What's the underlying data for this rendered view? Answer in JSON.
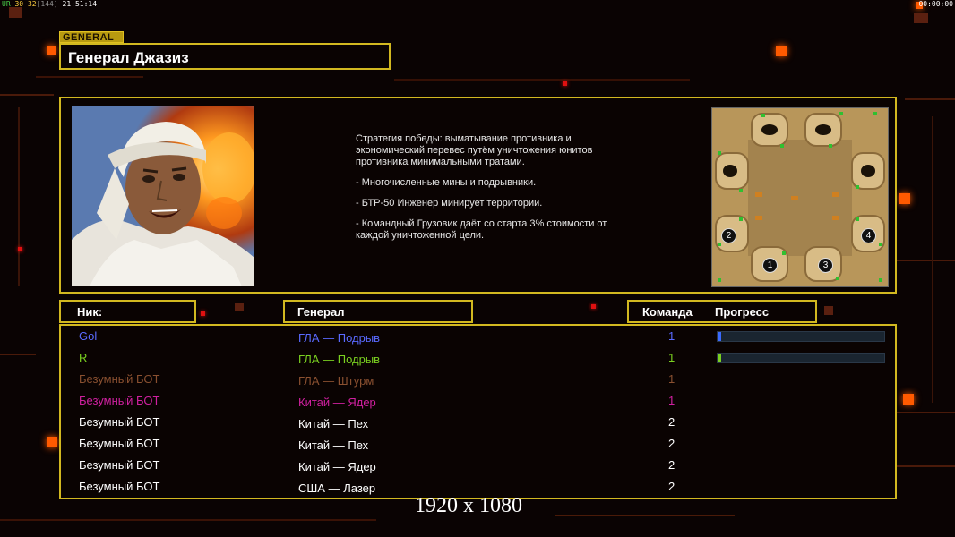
{
  "topbar": {
    "left_a": "UR",
    "left_b": "30",
    "left_c": "32",
    "left_d": "[144]",
    "left_time": "21:51:14",
    "right_time": "00:00:00"
  },
  "general_tag": "GENERAL",
  "general_name": "Генерал Джазиз",
  "strategy": {
    "line1": "Стратегия победы: выматывание противника и экономический перевес путём уничтожения юнитов противника минимальными тратами.",
    "bullet1": "- Многочисленные мины и подрывники.",
    "bullet2": "- БТР-50 Инженер минирует территории.",
    "bullet3": "- Командный Грузовик даёт со старта 3% стоимости от каждой уничтоженной цели."
  },
  "headers": {
    "nick": "Ник:",
    "general": "Генерал",
    "team": "Команда",
    "progress": "Прогресс"
  },
  "players": [
    {
      "nick": "Gol",
      "general": "ГЛА — Подрыв",
      "team": "1",
      "color": "#5a6aff",
      "progress": 0.01,
      "prog_color": "#3a6aff"
    },
    {
      "nick": "R",
      "general": "ГЛА — Подрыв",
      "team": "1",
      "color": "#7ad020",
      "progress": 0.01,
      "prog_color": "#7ad020"
    },
    {
      "nick": "Безумный БОТ",
      "general": "ГЛА — Штурм",
      "team": "1",
      "color": "#8a5030",
      "progress": null,
      "prog_color": ""
    },
    {
      "nick": "Безумный БОТ",
      "general": "Китай — Ядер",
      "team": "1",
      "color": "#d020a0",
      "progress": null,
      "prog_color": ""
    },
    {
      "nick": "Безумный БОТ",
      "general": "Китай — Пех",
      "team": "2",
      "color": "#ffffff",
      "progress": null,
      "prog_color": ""
    },
    {
      "nick": "Безумный БОТ",
      "general": "Китай — Пех",
      "team": "2",
      "color": "#ffffff",
      "progress": null,
      "prog_color": ""
    },
    {
      "nick": "Безумный БОТ",
      "general": "Китай — Ядер",
      "team": "2",
      "color": "#ffffff",
      "progress": null,
      "prog_color": ""
    },
    {
      "nick": "Безумный БОТ",
      "general": "США — Лазер",
      "team": "2",
      "color": "#ffffff",
      "progress": null,
      "prog_color": ""
    }
  ],
  "minimap_slots": [
    "1",
    "2",
    "3",
    "4"
  ],
  "resolution": "1920 x 1080",
  "colors": {
    "frame": "#d2b820",
    "accent": "#ff5a00",
    "background": "#0a0303"
  }
}
